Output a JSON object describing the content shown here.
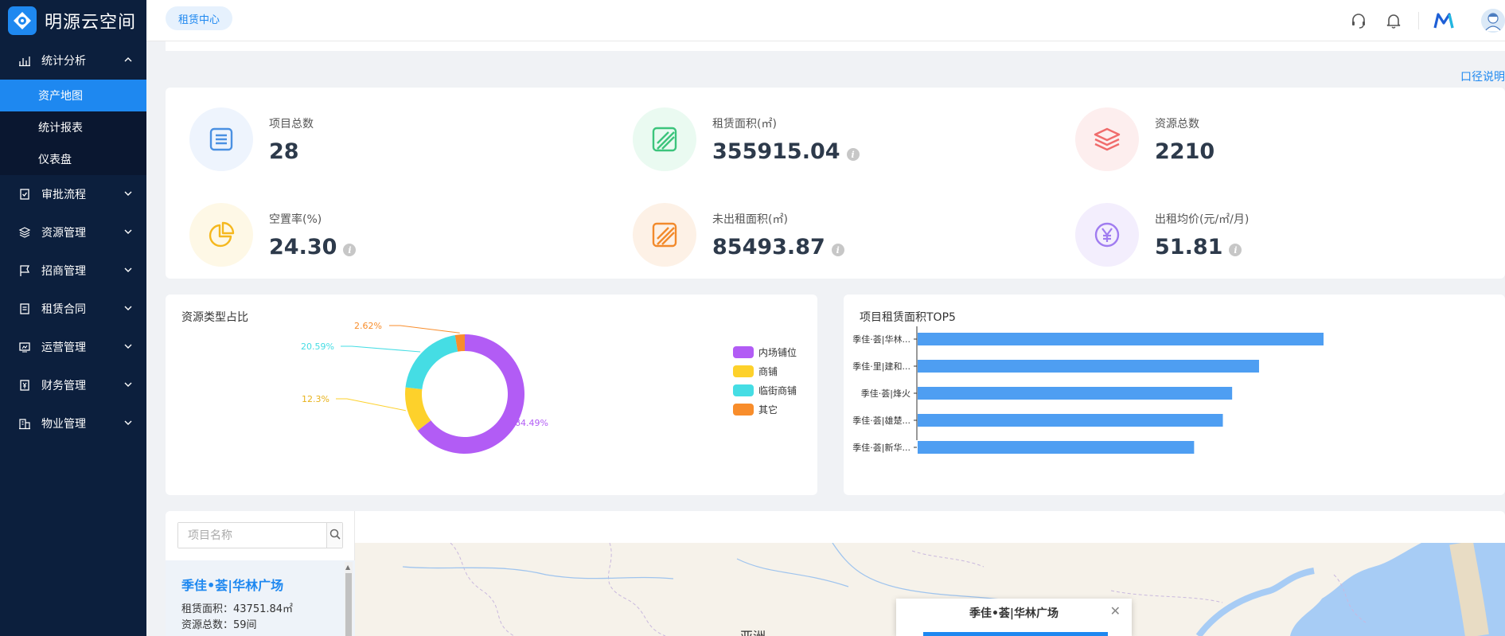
{
  "app": {
    "name": "明源云空间"
  },
  "sidebar": {
    "groups": [
      {
        "label": "统计分析",
        "expanded": true,
        "items": [
          "资产地图",
          "统计报表",
          "仪表盘"
        ],
        "active": "资产地图"
      },
      {
        "label": "审批流程"
      },
      {
        "label": "资源管理"
      },
      {
        "label": "招商管理"
      },
      {
        "label": "租赁合同"
      },
      {
        "label": "运营管理"
      },
      {
        "label": "财务管理"
      },
      {
        "label": "物业管理"
      }
    ]
  },
  "header": {
    "tab": "租赁中心"
  },
  "content": {
    "caliber_link": "口径说明"
  },
  "stats": [
    {
      "label": "项目总数",
      "value": "28",
      "icon": "list-icon",
      "color": "#4a90e2",
      "bg": "#eef4fd",
      "info": false
    },
    {
      "label": "租赁面积(㎡)",
      "value": "355915.04",
      "icon": "area-icon",
      "color": "#3cc47c",
      "bg": "#eafaf1",
      "info": true
    },
    {
      "label": "资源总数",
      "value": "2210",
      "icon": "layers-icon",
      "color": "#f06b6b",
      "bg": "#fdeeee",
      "info": false
    },
    {
      "label": "空置率(%)",
      "value": "24.30",
      "icon": "pie-icon",
      "color": "#f5b81e",
      "bg": "#fef8e6",
      "info": true
    },
    {
      "label": "未出租面积(㎡)",
      "value": "85493.87",
      "icon": "area-icon",
      "color": "#f28a2c",
      "bg": "#fdf1e6",
      "info": true
    },
    {
      "label": "出租均价(元/㎡/月)",
      "value": "51.81",
      "icon": "yen-icon",
      "color": "#a07cf0",
      "bg": "#f3eefd",
      "info": true
    }
  ],
  "donut": {
    "title": "资源类型占比",
    "labels": [
      "2.62%",
      "20.59%",
      "12.3%",
      "64.49%"
    ]
  },
  "bars": {
    "title": "项目租赁面积TOP5"
  },
  "chart_data": [
    {
      "type": "pie",
      "title": "资源类型占比",
      "categories": [
        "内场铺位",
        "商铺",
        "临街商铺",
        "其它"
      ],
      "values": [
        64.49,
        12.3,
        20.59,
        2.62
      ],
      "colors": [
        "#b25cf5",
        "#fdd12b",
        "#45dde4",
        "#f88d2b"
      ],
      "legend": "right"
    },
    {
      "type": "bar",
      "orientation": "horizontal",
      "title": "项目租赁面积TOP5",
      "categories": [
        "季佳·荟|华林...",
        "季佳·里|建和...",
        "季佳·荟|烽火",
        "季佳·荟|雄楚...",
        "季佳·荟|新华..."
      ],
      "values": [
        43751.84,
        36800,
        33900,
        32900,
        29800
      ],
      "color": "#4e9ef2"
    }
  ],
  "map": {
    "search_placeholder": "项目名称",
    "project": {
      "name": "季佳•荟|华林广场",
      "area_label": "租赁面积：",
      "area_value": "43751.84㎡",
      "count_label": "资源总数：",
      "count_value": "59间"
    },
    "popup_title": "季佳•荟|华林广场",
    "region_label": "亚洲"
  }
}
